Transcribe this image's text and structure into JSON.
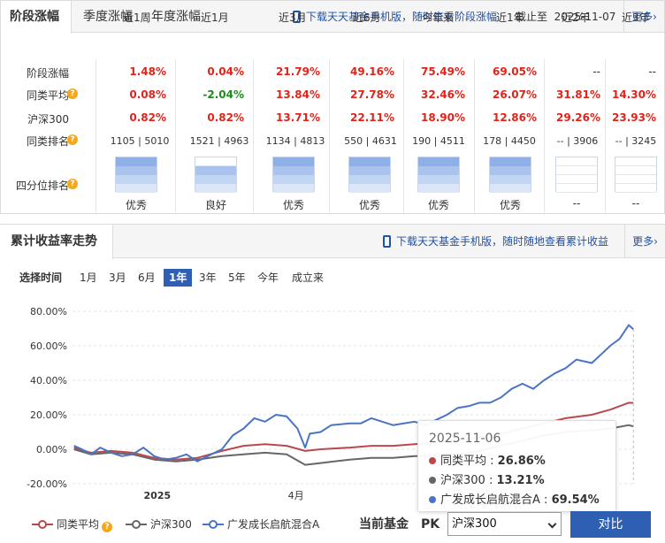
{
  "returns_panel": {
    "tabs": [
      "阶段涨幅",
      "季度涨幅",
      "年度涨幅"
    ],
    "promo": "下载天天基金手机版，随时查看阶段涨幅",
    "as_of_label": "截止至",
    "as_of_date": "2025-11-07",
    "more": "更多",
    "periods": [
      "近1周",
      "近1月",
      "近3月",
      "近6月",
      "今年来",
      "近1年",
      "近2年",
      "近3年"
    ],
    "rows": {
      "fund": {
        "label": "阶段涨幅",
        "values": [
          "1.48%",
          "0.04%",
          "21.79%",
          "49.16%",
          "75.49%",
          "69.05%",
          "--",
          "--"
        ]
      },
      "category_avg": {
        "label": "同类平均",
        "values": [
          "0.08%",
          "-2.04%",
          "13.84%",
          "27.78%",
          "32.46%",
          "26.07%",
          "31.81%",
          "14.30%"
        ]
      },
      "csi300": {
        "label": "沪深300",
        "values": [
          "0.82%",
          "0.82%",
          "13.71%",
          "22.11%",
          "18.90%",
          "12.86%",
          "29.26%",
          "23.93%"
        ]
      },
      "rank": {
        "label": "同类排名",
        "values": [
          "1105 | 5010",
          "1521 | 4963",
          "1134 | 4813",
          "550 | 4631",
          "190 | 4511",
          "178 | 4450",
          "-- | 3906",
          "-- | 3245"
        ]
      },
      "quartile": {
        "label": "四分位排名",
        "values": [
          "优秀",
          "良好",
          "优秀",
          "优秀",
          "优秀",
          "优秀",
          "--",
          "--"
        ],
        "levels": [
          4,
          3,
          4,
          4,
          4,
          4,
          0,
          0
        ]
      }
    }
  },
  "cumulative_panel": {
    "title": "累计收益率走势",
    "promo": "下载天天基金手机版，随时随地查看累计收益",
    "more": "更多",
    "time_label": "选择时间",
    "time_options": [
      "1月",
      "3月",
      "6月",
      "1年",
      "3年",
      "5年",
      "今年",
      "成立来"
    ],
    "time_selected": "1年",
    "tooltip": {
      "date": "2025-11-06",
      "rows": [
        {
          "name": "同类平均",
          "value": "26.86%",
          "color": "#b84a4f"
        },
        {
          "name": "沪深300",
          "value": "13.21%",
          "color": "#666666"
        },
        {
          "name": "广发成长启航混合A",
          "value": "69.54%",
          "color": "#4a74c4"
        }
      ]
    },
    "legend": [
      {
        "name": "同类平均",
        "color": "#b84a4f"
      },
      {
        "name": "沪深300",
        "color": "#666666"
      },
      {
        "name": "广发成长启航混合A",
        "color": "#4a74c4"
      }
    ],
    "current_fund_label": "当前基金",
    "pk_label": "PK",
    "pk_selected": "沪深300",
    "compare_button": "对比"
  },
  "chart_data": {
    "type": "line",
    "title": "",
    "ylim": [
      -20,
      80
    ],
    "yticks": [
      "80.00%",
      "60.00%",
      "40.00%",
      "20.00%",
      "0.00%",
      "-20.00%"
    ],
    "xtick_labels": [
      "2025",
      "4月"
    ],
    "x_range": [
      "2024-11-07",
      "2025-11-07"
    ],
    "grid": "horizontal",
    "legend_position": "bottom",
    "series": [
      {
        "name": "广发成长启航混合A",
        "color": "#4a74c4",
        "x": [
          "2024-11-08",
          "2024-11-13",
          "2024-11-19",
          "2024-11-25",
          "2024-12-02",
          "2024-12-09",
          "2024-12-16",
          "2024-12-23",
          "2024-12-30",
          "2025-01-06",
          "2025-01-13",
          "2025-01-20",
          "2025-01-27",
          "2025-02-05",
          "2025-02-12",
          "2025-02-19",
          "2025-02-26",
          "2025-03-05",
          "2025-03-12",
          "2025-03-19",
          "2025-03-26",
          "2025-04-02",
          "2025-04-07",
          "2025-04-10",
          "2025-04-17",
          "2025-04-24",
          "2025-05-06",
          "2025-05-13",
          "2025-05-20",
          "2025-05-27",
          "2025-06-03",
          "2025-06-10",
          "2025-06-17",
          "2025-06-24",
          "2025-07-01",
          "2025-07-08",
          "2025-07-15",
          "2025-07-22",
          "2025-07-29",
          "2025-08-05",
          "2025-08-12",
          "2025-08-19",
          "2025-08-26",
          "2025-09-02",
          "2025-09-09",
          "2025-09-16",
          "2025-09-23",
          "2025-09-30",
          "2025-10-10",
          "2025-10-16",
          "2025-10-22",
          "2025-10-28",
          "2025-11-03",
          "2025-11-06"
        ],
        "values": [
          2,
          0,
          -3,
          1,
          -2,
          -4,
          -3,
          1,
          -4,
          -6,
          -5,
          -3,
          -7,
          -3,
          0,
          8,
          12,
          18,
          16,
          20,
          19,
          12,
          1,
          9,
          10,
          14,
          15,
          15,
          18,
          16,
          14,
          15,
          16,
          14,
          17,
          20,
          24,
          25,
          27,
          27,
          30,
          35,
          38,
          35,
          40,
          44,
          47,
          52,
          50,
          55,
          60,
          64,
          72,
          69.54
        ]
      },
      {
        "name": "同类平均",
        "color": "#b84a4f",
        "x": [
          "2024-11-08",
          "2024-11-19",
          "2024-12-02",
          "2024-12-16",
          "2024-12-30",
          "2025-01-13",
          "2025-01-27",
          "2025-02-12",
          "2025-02-26",
          "2025-03-12",
          "2025-03-26",
          "2025-04-07",
          "2025-04-17",
          "2025-05-06",
          "2025-05-20",
          "2025-06-03",
          "2025-06-17",
          "2025-07-01",
          "2025-07-15",
          "2025-07-29",
          "2025-08-12",
          "2025-08-26",
          "2025-09-09",
          "2025-09-23",
          "2025-10-10",
          "2025-10-22",
          "2025-11-03",
          "2025-11-06"
        ],
        "values": [
          1,
          -2,
          -1,
          -2,
          -5,
          -6,
          -5,
          -1,
          2,
          3,
          2,
          -1,
          0,
          1,
          2,
          2,
          3,
          4,
          5,
          7,
          9,
          12,
          15,
          18,
          20,
          23,
          27,
          26.86
        ]
      },
      {
        "name": "沪深300",
        "color": "#666666",
        "x": [
          "2024-11-08",
          "2024-11-19",
          "2024-12-02",
          "2024-12-16",
          "2024-12-30",
          "2025-01-13",
          "2025-01-27",
          "2025-02-12",
          "2025-02-26",
          "2025-03-12",
          "2025-03-26",
          "2025-04-07",
          "2025-04-17",
          "2025-05-06",
          "2025-05-20",
          "2025-06-03",
          "2025-06-17",
          "2025-07-01",
          "2025-07-15",
          "2025-07-29",
          "2025-08-12",
          "2025-08-26",
          "2025-09-09",
          "2025-09-23",
          "2025-10-10",
          "2025-10-22",
          "2025-11-03",
          "2025-11-06"
        ],
        "values": [
          0,
          -3,
          -2,
          -3,
          -6,
          -7,
          -6,
          -4,
          -3,
          -2,
          -3,
          -9,
          -8,
          -6,
          -5,
          -5,
          -4,
          -4,
          -3,
          -1,
          2,
          5,
          8,
          10,
          11,
          12,
          14,
          13.21
        ]
      }
    ]
  }
}
